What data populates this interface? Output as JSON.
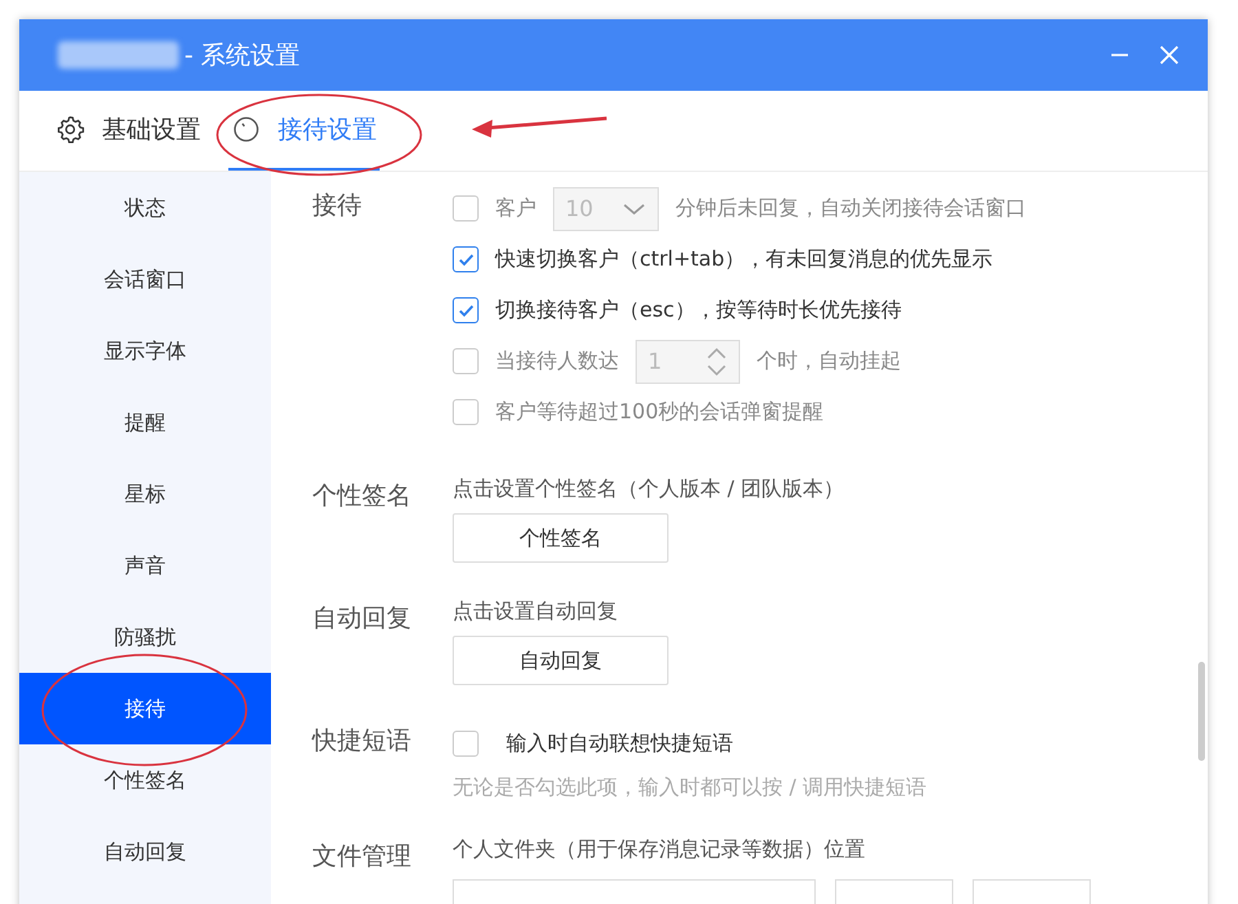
{
  "window": {
    "title": "- 系统设置"
  },
  "tabs": [
    {
      "label": "基础设置",
      "selected": false
    },
    {
      "label": "接待设置",
      "selected": true
    }
  ],
  "sidebar": {
    "items": [
      {
        "label": "状态",
        "selected": false
      },
      {
        "label": "会话窗口",
        "selected": false
      },
      {
        "label": "显示字体",
        "selected": false
      },
      {
        "label": "提醒",
        "selected": false
      },
      {
        "label": "星标",
        "selected": false
      },
      {
        "label": "声音",
        "selected": false
      },
      {
        "label": "防骚扰",
        "selected": false
      },
      {
        "label": "接待",
        "selected": true
      },
      {
        "label": "个性签名",
        "selected": false
      },
      {
        "label": "自动回复",
        "selected": false
      }
    ]
  },
  "reception": {
    "label": "接待",
    "options": [
      {
        "kind": "select",
        "checked": false,
        "prefix": "客户",
        "value": "10",
        "suffix": "分钟后未回复，自动关闭接待会话窗口"
      },
      {
        "kind": "plain",
        "checked": true,
        "label": "快速切换客户（ctrl+tab），有未回复消息的优先显示"
      },
      {
        "kind": "plain",
        "checked": true,
        "label": "切换接待客户（esc），按等待时长优先接待"
      },
      {
        "kind": "stepper",
        "checked": false,
        "prefix": "当接待人数达",
        "value": "1",
        "suffix": "个时，自动挂起"
      },
      {
        "kind": "plain",
        "checked": false,
        "label": "客户等待超过100秒的会话弹窗提醒"
      }
    ]
  },
  "signature": {
    "label": "个性签名",
    "hint": "点击设置个性签名（个人版本 / 团队版本）",
    "button": "个性签名"
  },
  "auto_reply": {
    "label": "自动回复",
    "hint": "点击设置自动回复",
    "button": "自动回复"
  },
  "quick_phrases": {
    "label": "快捷短语",
    "option": {
      "checked": false,
      "label": "输入时自动联想快捷短语"
    },
    "note": "无论是否勾选此项，输入时都可以按 / 调用快捷短语"
  },
  "file_management": {
    "label": "文件管理",
    "hint": "个人文件夹（用于保存消息记录等数据）位置"
  }
}
